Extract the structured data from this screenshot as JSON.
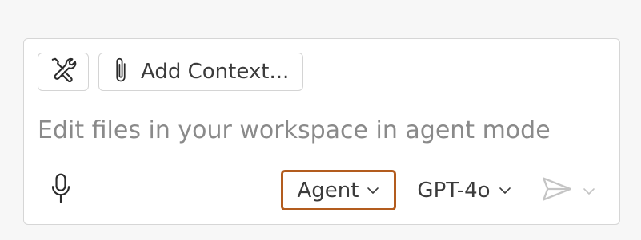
{
  "chat_input": {
    "tools_icon": "tools-icon",
    "add_context_label": "Add Context...",
    "placeholder": "Edit files in your workspace in agent mode",
    "mode_label": "Agent",
    "model_label": "GPT-4o"
  },
  "colors": {
    "panel_border": "#d6d6d6",
    "mode_highlight": "#b35c1e",
    "placeholder_text": "#8a8a8a",
    "send_disabled": "#c4c4c4"
  }
}
